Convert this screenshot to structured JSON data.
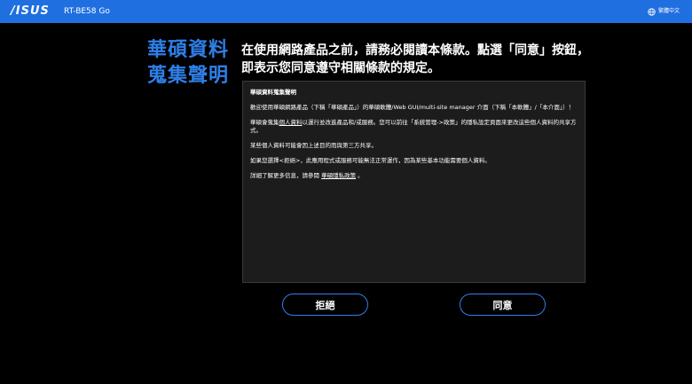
{
  "header": {
    "logo_text": "/ISUS",
    "model": "RT-BE58 Go",
    "language_label": "繁體中文",
    "language_icon": "globe-icon",
    "bar_color": "#1f6fe0"
  },
  "side_title": {
    "line1": "華碩資料",
    "line2": "蒐集聲明",
    "color": "#2f7fe8"
  },
  "heading": {
    "line1": "在使用網路產品之前，請務必閱讀本條款。點選「同意」按鈕，",
    "line2": "即表示您同意遵守相關條款的規定。"
  },
  "panel": {
    "title": "華碩資料蒐集聲明",
    "para1": "歡迎使用華碩網路產品（下稱「華碩產品」）的華碩軟體/Web GUI/multi-site manager 介面（下稱「本軟體」/「本介面」）！",
    "para2_a": "華碩會蒐集",
    "para2_link": "個人資料",
    "para2_b": "以運行並改進產品和/或服務。您可以前往「系統管理->政策」的隱私設定頁面來更改這些個人資料的共享方式。",
    "para3": "某些個人資料可能會因上述目的而與第三方共享。",
    "para4": "如果您選擇<拒絕>，此應用程式或服務可能無法正常運作，因為某些基本功能需要個人資料。",
    "para5_a": "詳細了解更多信息，請參閱 ",
    "para5_link": "華碩隱私政策",
    "para5_b": " 。"
  },
  "buttons": {
    "decline": "拒絕",
    "agree": "同意",
    "border_color": "#2f7fe8"
  }
}
